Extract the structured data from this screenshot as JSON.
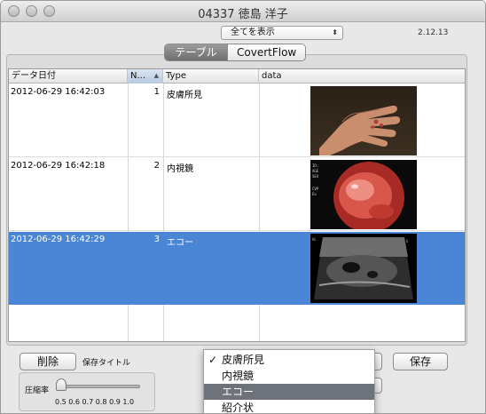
{
  "window": {
    "title": "04337 徳島 洋子"
  },
  "filter": {
    "selected": "全てを表示",
    "arrow": "⬍"
  },
  "version": "2.12.13",
  "tabs": [
    {
      "label": "テーブル"
    },
    {
      "label": "CovertFlow"
    }
  ],
  "table": {
    "headers": {
      "date": "データ日付",
      "num": "N...",
      "type": "Type",
      "data": "data"
    },
    "rows": [
      {
        "date": "2012-06-29 16:42:03",
        "num": "1",
        "type": "皮膚所見",
        "image": "hand-skin-photo"
      },
      {
        "date": "2012-06-29 16:42:18",
        "num": "2",
        "type": "内視鏡",
        "image": "endoscopy-photo"
      },
      {
        "date": "2012-06-29 16:42:29",
        "num": "3",
        "type": "エコー",
        "image": "ultrasound-scan"
      }
    ],
    "selected_row": 2
  },
  "bottom": {
    "delete_label": "削除",
    "save_title_label": "保存タイトル",
    "save_label": "保存",
    "compression_label": "圧縮率",
    "scale": "0.5 0.6 0.7 0.8 0.9 1.0"
  },
  "menu": {
    "items": [
      {
        "label": "皮膚所見",
        "checked": true
      },
      {
        "label": "内視鏡",
        "checked": false
      },
      {
        "label": "エコー",
        "checked": false,
        "highlighted": true
      },
      {
        "label": "紹介状",
        "checked": false
      }
    ],
    "checkmark": "✓"
  }
}
